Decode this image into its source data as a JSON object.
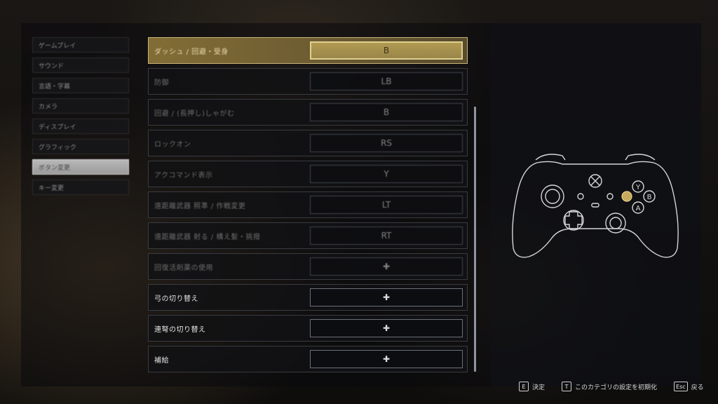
{
  "menu": {
    "items": [
      {
        "label": "ゲームプレイ"
      },
      {
        "label": "サウンド"
      },
      {
        "label": "言語・字幕"
      },
      {
        "label": "カメラ"
      },
      {
        "label": "ディスプレイ"
      },
      {
        "label": "グラフィック"
      },
      {
        "label": "ボタン変更"
      },
      {
        "label": "キー変更"
      }
    ],
    "active_index": 6
  },
  "bindings": [
    {
      "label": "ダッシュ / 回避・受身",
      "button": "B"
    },
    {
      "label": "防御",
      "button": "LB"
    },
    {
      "label": "回避 / (長押し)しゃがむ",
      "button": "B"
    },
    {
      "label": "ロックオン",
      "button": "RS"
    },
    {
      "label": "アクコマンド表示",
      "button": "Y"
    },
    {
      "label": "遠距離武器 照準 / 作戦変更",
      "button": "LT"
    },
    {
      "label": "遠距離武器 射る / 構え髪・挑撥",
      "button": "RT"
    },
    {
      "label": "回復活剤薬の使用",
      "button": "✚"
    },
    {
      "label": "弓の切り替え",
      "button": "✚"
    },
    {
      "label": "連弩の切り替え",
      "button": "✚"
    },
    {
      "label": "補給",
      "button": "✚"
    }
  ],
  "controller": {
    "face_buttons": {
      "y": "Y",
      "b": "B",
      "a": "A"
    },
    "highlight_color": "#c8a95a"
  },
  "footer": {
    "confirm_key": "E",
    "confirm_label": "決定",
    "reset_key": "T",
    "reset_label": "このカテゴリの設定を初期化",
    "back_key": "Esc",
    "back_label": "戻る"
  }
}
